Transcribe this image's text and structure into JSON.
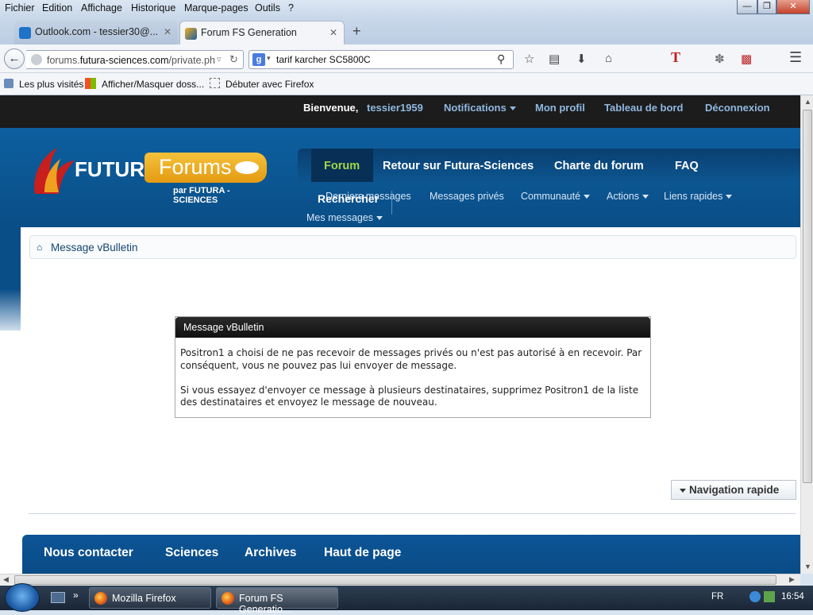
{
  "menubar": {
    "items": [
      "Fichier",
      "Edition",
      "Affichage",
      "Historique",
      "Marque-pages",
      "Outils",
      "?"
    ]
  },
  "tabs": [
    {
      "label": "Outlook.com - tessier30@..."
    },
    {
      "label": "Forum FS Generation"
    }
  ],
  "navbar": {
    "url_prefix": "forums.",
    "url_domain": "futura-sciences.com",
    "url_path": "/private.ph",
    "search_value": "tarif karcher SC5800C"
  },
  "bookmarks": [
    "Les plus visités",
    "Afficher/Masquer doss...",
    "Débuter avec Firefox"
  ],
  "site": {
    "welcome": "Bienvenue,",
    "username": "tessier1959",
    "top_links": [
      "Notifications",
      "Mon profil",
      "Tableau de bord",
      "Déconnexion"
    ],
    "logo": {
      "futura": "FUTURA",
      "forums": "Forums",
      "par": "par  FUTURA - SCIENCES"
    },
    "main_nav": [
      "Forum",
      "Retour sur Futura-Sciences",
      "Charte du forum",
      "FAQ"
    ],
    "sub_nav": [
      "Derniers messages",
      "Messages privés",
      "Communauté",
      "Actions",
      "Liens rapides"
    ],
    "sub_nav2": "Mes messages",
    "search_label": "Rechercher",
    "breadcrumb": "Message vBulletin",
    "message": {
      "title": "Message vBulletin",
      "para1": "Positron1 a choisi de ne pas recevoir de messages privés ou n'est pas autorisé à en recevoir. Par conséquent, vous ne pouvez pas lui envoyer de message.",
      "para2": "Si vous essayez d'envoyer ce message à plusieurs destinataires, supprimez Positron1 de la liste des destinataires et envoyez le message de nouveau."
    },
    "quick_nav": "Navigation rapide",
    "footer_links": [
      "Nous contacter",
      "Sciences",
      "Archives",
      "Haut de page"
    ]
  },
  "taskbar": {
    "buttons": [
      "Mozilla Firefox",
      "Forum FS Generatio..."
    ],
    "lang": "FR",
    "time": "16:54"
  },
  "colors": {
    "nav_active": "#9fd64a",
    "header_blue": "#0a4e87",
    "top_strip": "#1c1c1c",
    "link": "#8fb8e0"
  }
}
